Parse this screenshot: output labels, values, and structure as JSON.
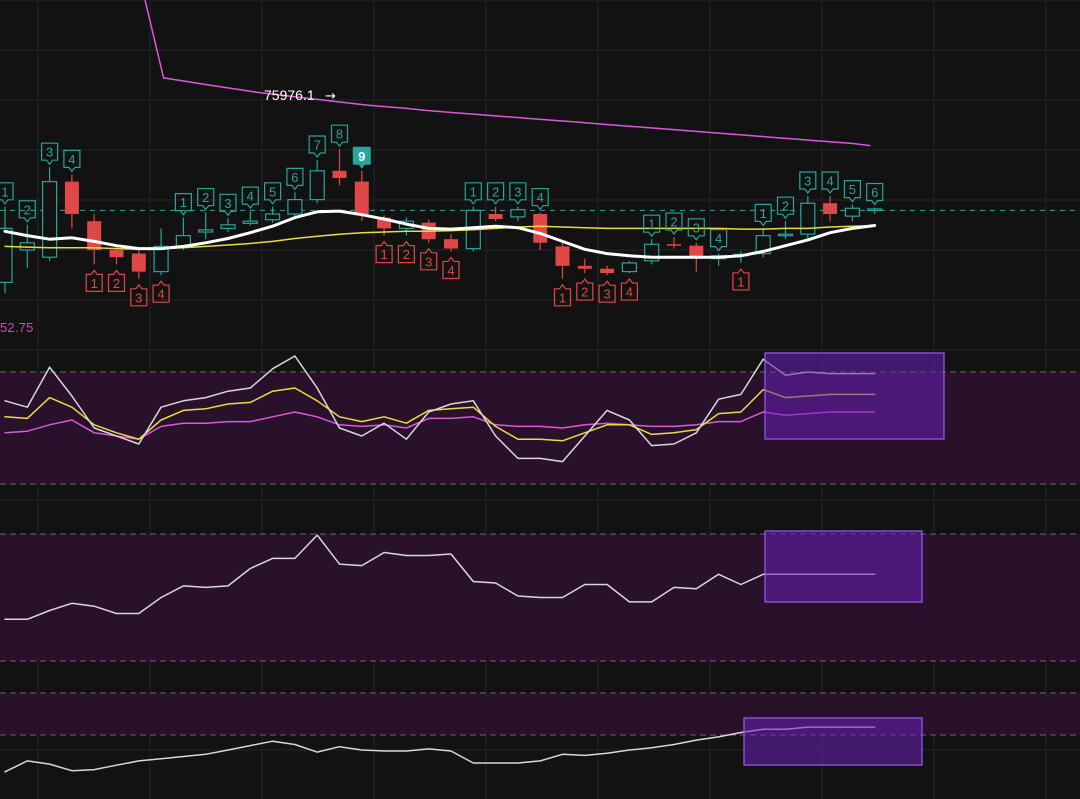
{
  "rsi_label": "52.75",
  "price_annotation": "75976.1",
  "arrow_glyph": "→",
  "colors": {
    "background": "#121212",
    "grid": "#242424",
    "bull": "#26a69a",
    "bear": "#e04848",
    "dashed_line": "#26a69a",
    "ma_fast": "#ffffff",
    "ma_slow": "#e8dd40",
    "ma_long": "#d85ad8",
    "band_fill": "#2e1030",
    "band_edge": "#a0a0a0",
    "highlight_fill": "#6a1fb8",
    "highlight_edge": "#9a5cf0",
    "signal_badge": "#26a69a"
  },
  "chart_data": [
    {
      "type": "candlestick",
      "description_panel": "price",
      "ylim": [
        75840,
        76090
      ],
      "dashed_level": 75895,
      "candles": [
        {
          "o": 75795,
          "h": 75900,
          "l": 75780,
          "c": 75870
        },
        {
          "o": 75840,
          "h": 75875,
          "l": 75815,
          "c": 75850
        },
        {
          "o": 75830,
          "h": 75955,
          "l": 75825,
          "c": 75935
        },
        {
          "o": 75935,
          "h": 75945,
          "l": 75870,
          "c": 75890
        },
        {
          "o": 75880,
          "h": 75890,
          "l": 75820,
          "c": 75840
        },
        {
          "o": 75840,
          "h": 75845,
          "l": 75820,
          "c": 75830
        },
        {
          "o": 75835,
          "h": 75840,
          "l": 75800,
          "c": 75810
        },
        {
          "o": 75810,
          "h": 75870,
          "l": 75805,
          "c": 75845
        },
        {
          "o": 75845,
          "h": 75885,
          "l": 75840,
          "c": 75860
        },
        {
          "o": 75865,
          "h": 75892,
          "l": 75855,
          "c": 75868
        },
        {
          "o": 75870,
          "h": 75884,
          "l": 75865,
          "c": 75875
        },
        {
          "o": 75877,
          "h": 75894,
          "l": 75874,
          "c": 75880
        },
        {
          "o": 75882,
          "h": 75900,
          "l": 75878,
          "c": 75890
        },
        {
          "o": 75890,
          "h": 75920,
          "l": 75885,
          "c": 75910
        },
        {
          "o": 75910,
          "h": 75965,
          "l": 75905,
          "c": 75950
        },
        {
          "o": 75950,
          "h": 75980,
          "l": 75930,
          "c": 75940
        },
        {
          "o": 75935,
          "h": 75950,
          "l": 75880,
          "c": 75890
        },
        {
          "o": 75885,
          "h": 75888,
          "l": 75860,
          "c": 75870
        },
        {
          "o": 75870,
          "h": 75885,
          "l": 75860,
          "c": 75880
        },
        {
          "o": 75878,
          "h": 75882,
          "l": 75850,
          "c": 75855
        },
        {
          "o": 75855,
          "h": 75862,
          "l": 75838,
          "c": 75842
        },
        {
          "o": 75842,
          "h": 75900,
          "l": 75838,
          "c": 75895
        },
        {
          "o": 75890,
          "h": 75900,
          "l": 75880,
          "c": 75883
        },
        {
          "o": 75886,
          "h": 75900,
          "l": 75880,
          "c": 75896
        },
        {
          "o": 75890,
          "h": 75892,
          "l": 75840,
          "c": 75850
        },
        {
          "o": 75845,
          "h": 75850,
          "l": 75800,
          "c": 75818
        },
        {
          "o": 75818,
          "h": 75828,
          "l": 75808,
          "c": 75814
        },
        {
          "o": 75814,
          "h": 75818,
          "l": 75805,
          "c": 75808
        },
        {
          "o": 75810,
          "h": 75825,
          "l": 75808,
          "c": 75822
        },
        {
          "o": 75825,
          "h": 75855,
          "l": 75820,
          "c": 75848
        },
        {
          "o": 75848,
          "h": 75858,
          "l": 75842,
          "c": 75846
        },
        {
          "o": 75846,
          "h": 75850,
          "l": 75810,
          "c": 75830
        },
        {
          "o": 75828,
          "h": 75835,
          "l": 75818,
          "c": 75832
        },
        {
          "o": 75832,
          "h": 75838,
          "l": 75822,
          "c": 75834
        },
        {
          "o": 75835,
          "h": 75870,
          "l": 75830,
          "c": 75860
        },
        {
          "o": 75860,
          "h": 75880,
          "l": 75855,
          "c": 75862
        },
        {
          "o": 75862,
          "h": 75915,
          "l": 75855,
          "c": 75905
        },
        {
          "o": 75905,
          "h": 75915,
          "l": 75880,
          "c": 75890
        },
        {
          "o": 75887,
          "h": 75903,
          "l": 75880,
          "c": 75898
        },
        {
          "o": 75896,
          "h": 75899,
          "l": 75890,
          "c": 75897
        }
      ],
      "ma_fast": [
        75866,
        75860,
        75855,
        75857,
        75852,
        75846,
        75842,
        75842,
        75845,
        75850,
        75856,
        75864,
        75873,
        75885,
        75893,
        75894,
        75889,
        75883,
        75876,
        75870,
        75869,
        75871,
        75873,
        75871,
        75863,
        75852,
        75841,
        75835,
        75832,
        75830,
        75830,
        75830,
        75830,
        75832,
        75838,
        75846,
        75854,
        75864,
        75870,
        75874
      ],
      "ma_slow": [
        75845,
        75844,
        75843,
        75843,
        75843,
        75842,
        75841,
        75842,
        75843,
        75845,
        75847,
        75849,
        75852,
        75856,
        75859,
        75862,
        75864,
        75865,
        75866,
        75866,
        75867,
        75868,
        75870,
        75872,
        75873,
        75872,
        75871,
        75870,
        75870,
        75870,
        75870,
        75870,
        75870,
        75869,
        75869,
        75870,
        75870,
        75872,
        75873,
        75874
      ],
      "ma_long": [
        76085,
        76079,
        76075,
        76071,
        76067,
        76063,
        76059,
        76056,
        76053,
        76050,
        76047,
        76044,
        76041,
        76039,
        76037,
        76034,
        76032,
        76030,
        76028,
        76026,
        76024,
        76022,
        76020,
        76018,
        76016,
        76014,
        76012,
        76010,
        76008,
        76006,
        76004,
        76002,
        76000,
        75998,
        75996,
        75994,
        75992,
        75990,
        75988,
        75985
      ],
      "signals": [
        {
          "i": 0,
          "label": "1",
          "kind": "bull"
        },
        {
          "i": 1,
          "label": "2",
          "kind": "bull"
        },
        {
          "i": 2,
          "label": "3",
          "kind": "bull"
        },
        {
          "i": 3,
          "label": "4",
          "kind": "bull"
        },
        {
          "i": 4,
          "label": "1",
          "kind": "bear"
        },
        {
          "i": 5,
          "label": "2",
          "kind": "bear"
        },
        {
          "i": 6,
          "label": "3",
          "kind": "bear"
        },
        {
          "i": 7,
          "label": "4",
          "kind": "bear"
        },
        {
          "i": 8,
          "label": "1",
          "kind": "bull"
        },
        {
          "i": 9,
          "label": "2",
          "kind": "bull"
        },
        {
          "i": 10,
          "label": "3",
          "kind": "bull"
        },
        {
          "i": 11,
          "label": "4",
          "kind": "bull"
        },
        {
          "i": 12,
          "label": "5",
          "kind": "bull"
        },
        {
          "i": 13,
          "label": "6",
          "kind": "bull"
        },
        {
          "i": 14,
          "label": "7",
          "kind": "bull"
        },
        {
          "i": 15,
          "label": "8",
          "kind": "bull"
        },
        {
          "i": 16,
          "label": "9",
          "kind": "final"
        },
        {
          "i": 17,
          "label": "1",
          "kind": "bear"
        },
        {
          "i": 18,
          "label": "2",
          "kind": "bear"
        },
        {
          "i": 19,
          "label": "3",
          "kind": "bear"
        },
        {
          "i": 20,
          "label": "4",
          "kind": "bear"
        },
        {
          "i": 21,
          "label": "1",
          "kind": "bull"
        },
        {
          "i": 22,
          "label": "2",
          "kind": "bull"
        },
        {
          "i": 23,
          "label": "3",
          "kind": "bull"
        },
        {
          "i": 24,
          "label": "4",
          "kind": "bull"
        },
        {
          "i": 25,
          "label": "1",
          "kind": "bear"
        },
        {
          "i": 26,
          "label": "2",
          "kind": "bear"
        },
        {
          "i": 27,
          "label": "3",
          "kind": "bear"
        },
        {
          "i": 28,
          "label": "4",
          "kind": "bear"
        },
        {
          "i": 29,
          "label": "1",
          "kind": "bull"
        },
        {
          "i": 30,
          "label": "2",
          "kind": "bull"
        },
        {
          "i": 31,
          "label": "3",
          "kind": "bull"
        },
        {
          "i": 32,
          "label": "4",
          "kind": "bull"
        },
        {
          "i": 33,
          "label": "1",
          "kind": "bear"
        },
        {
          "i": 34,
          "label": "1",
          "kind": "bull"
        },
        {
          "i": 35,
          "label": "2",
          "kind": "bull"
        },
        {
          "i": 36,
          "label": "3",
          "kind": "bull"
        },
        {
          "i": 37,
          "label": "4",
          "kind": "bull"
        },
        {
          "i": 38,
          "label": "5",
          "kind": "bull"
        },
        {
          "i": 39,
          "label": "6",
          "kind": "bull"
        }
      ]
    },
    {
      "type": "line",
      "description_panel": "indicator-1",
      "ylim": [
        0,
        100
      ],
      "band": [
        25,
        75
      ],
      "series": [
        {
          "color": "white",
          "values": [
            62,
            58,
            83,
            65,
            45,
            40,
            35,
            58,
            62,
            64,
            68,
            70,
            82,
            90,
            70,
            45,
            40,
            48,
            38,
            55,
            60,
            62,
            40,
            26,
            26,
            24,
            40,
            56,
            50,
            34,
            35,
            42,
            63,
            66,
            88,
            78,
            80,
            79,
            79,
            79
          ]
        },
        {
          "color": "yellow",
          "values": [
            52,
            51,
            64,
            58,
            47,
            42,
            38,
            50,
            56,
            57,
            60,
            61,
            68,
            70,
            62,
            52,
            49,
            52,
            48,
            56,
            57,
            58,
            46,
            38,
            38,
            37,
            42,
            47,
            47,
            41,
            42,
            44,
            54,
            55,
            69,
            64,
            65,
            66,
            66,
            66
          ]
        },
        {
          "color": "magenta",
          "values": [
            42,
            43,
            47,
            50,
            42,
            40,
            38,
            46,
            48,
            48,
            49,
            49,
            52,
            55,
            52,
            47,
            46,
            47,
            45,
            51,
            51,
            52,
            47,
            46,
            46,
            45,
            47,
            48,
            47,
            46,
            46,
            47,
            49,
            49,
            55,
            53,
            54,
            55,
            55,
            55
          ]
        }
      ]
    },
    {
      "type": "line",
      "description_panel": "indicator-2",
      "ylim": [
        0,
        100
      ],
      "band": [
        15,
        95
      ],
      "series": [
        {
          "color": "white",
          "values": [
            35,
            35,
            41,
            46,
            44,
            39,
            39,
            50,
            58,
            57,
            58,
            70,
            77,
            77,
            93,
            73,
            72,
            81,
            79,
            79,
            80,
            61,
            60,
            51,
            50,
            50,
            59,
            59,
            47,
            47,
            57,
            56,
            66,
            59,
            66,
            66,
            66,
            66,
            66,
            66
          ]
        }
      ]
    },
    {
      "type": "line",
      "description_panel": "indicator-3",
      "ylim": [
        0,
        100
      ],
      "band": [
        60,
        95
      ],
      "series": [
        {
          "color": "white",
          "values": [
            25,
            35,
            32,
            26,
            27,
            31,
            35,
            37,
            39,
            41,
            45,
            49,
            53,
            50,
            43,
            48,
            45,
            44,
            44,
            46,
            44,
            33,
            33,
            33,
            35,
            41,
            40,
            42,
            45,
            47,
            50,
            54,
            57,
            61,
            64,
            64,
            66,
            66,
            66,
            66
          ]
        }
      ]
    }
  ]
}
